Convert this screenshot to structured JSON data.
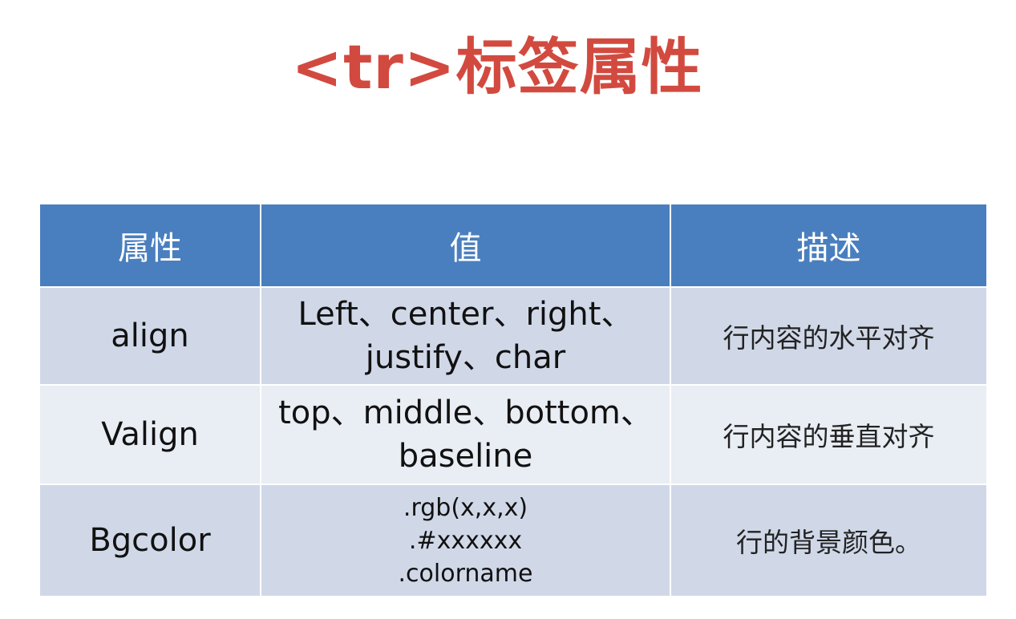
{
  "title": "<tr>标签属性",
  "table": {
    "headers": [
      "属性",
      "值",
      "描述"
    ],
    "rows": [
      {
        "name": "align",
        "value_lines": [
          "Left、center、right、",
          "justify、char"
        ],
        "description": "行内容的水平对齐"
      },
      {
        "name": "Valign",
        "value_lines": [
          "top、middle、bottom、",
          "baseline"
        ],
        "description": "行内容的垂直对齐"
      },
      {
        "name": "Bgcolor",
        "value_lines": [
          ".rgb(x,x,x)",
          ".#xxxxxx",
          ".colorname"
        ],
        "description": "行的背景颜色。"
      }
    ]
  },
  "colors": {
    "title": "#d24a3f",
    "header_bg": "#4a7fbf",
    "row_odd_bg": "#d0d8e8",
    "row_even_bg": "#e9edf4"
  }
}
